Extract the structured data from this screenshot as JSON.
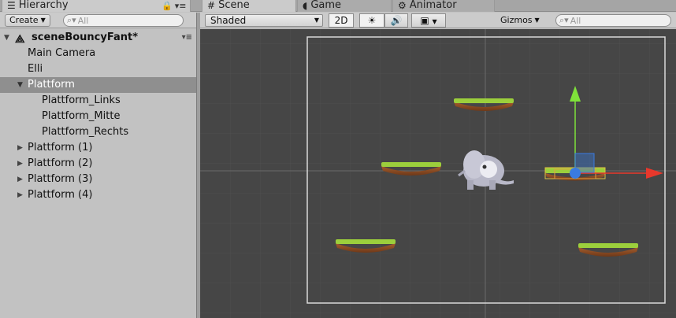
{
  "tabs": {
    "hierarchy": "Hierarchy",
    "scene": "Scene",
    "game": "Game",
    "animator": "Animator"
  },
  "hierarchy": {
    "create_label": "Create",
    "search_placeholder": "All",
    "scene_name": "sceneBouncyFant*",
    "items": [
      {
        "label": "Main Camera"
      },
      {
        "label": "Elli"
      },
      {
        "label": "Plattform"
      },
      {
        "label": "Plattform_Links"
      },
      {
        "label": "Plattform_Mitte"
      },
      {
        "label": "Plattform_Rechts"
      },
      {
        "label": "Plattform (1)"
      },
      {
        "label": "Plattform (2)"
      },
      {
        "label": "Plattform (3)"
      },
      {
        "label": "Plattform (4)"
      }
    ]
  },
  "scene_toolbar": {
    "draw_mode": "Shaded",
    "mode_2d": "2D",
    "gizmos_label": "Gizmos",
    "search_placeholder": "All"
  },
  "icons": {
    "hierarchy_tab": "list-icon",
    "scene_tab": "grid-icon",
    "game_tab": "pacman-icon",
    "animator_tab": "animator-icon",
    "lighting": "sun-icon",
    "audio": "speaker-icon",
    "effects": "image-icon",
    "search": "search-icon",
    "scene": "unity-logo-icon"
  },
  "colors": {
    "selection": "#8f8f8f",
    "viewport_bg": "#464646",
    "gizmo_y": "#7fe23a",
    "gizmo_x": "#e8382c",
    "gizmo_center": "#3a7be0",
    "grass": "#9ccf3c",
    "dirt": "#8b4a24"
  }
}
